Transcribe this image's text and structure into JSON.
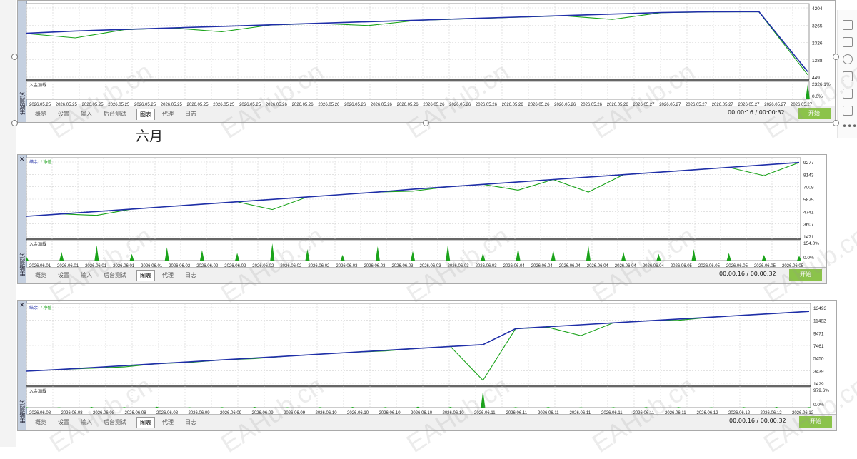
{
  "month_heading": "六月",
  "watermark": "EAHub.cn",
  "tabs": [
    "概览",
    "设置",
    "输入",
    "后台测试",
    "图表",
    "代理",
    "日志"
  ],
  "active_tab": "图表",
  "side_label": "策略测试",
  "timer": "00:00:16 / 00:00:32",
  "start_label": "开始",
  "colors": {
    "balance": "#1f2ea8",
    "equity": "#1aa31a",
    "grid": "#d0d0d0",
    "accent": "#8bc34a"
  },
  "panels": [
    {
      "legend_balance": "",
      "legend_equity": "",
      "load_label": "入金加载",
      "y_ticks": [
        "4204",
        "3265",
        "2326",
        "1388",
        "449"
      ],
      "load_ticks": [
        "2326.1%",
        "0.0%"
      ],
      "x_labels": [
        "2026.05.25",
        "2026.05.25",
        "2026.05.25",
        "2026.05.25",
        "2026.05.25",
        "2026.05.25",
        "2026.05.25",
        "2026.05.25",
        "2026.05.25",
        "2026.05.26",
        "2026.05.26",
        "2026.05.26",
        "2026.05.26",
        "2026.05.26",
        "2026.05.26",
        "2026.05.26",
        "2026.05.26",
        "2026.05.26",
        "2026.05.26",
        "2026.05.26",
        "2026.05.26",
        "2026.05.26",
        "2026.05.26",
        "2026.05.27",
        "2026.05.27",
        "2026.05.27",
        "2026.05.27",
        "2026.05.27",
        "2026.05.27",
        "2026.05.27"
      ]
    },
    {
      "legend_balance": "结余",
      "legend_equity": "净值",
      "load_label": "入金加载",
      "y_ticks": [
        "9277",
        "8143",
        "7009",
        "5875",
        "4741",
        "3607",
        "1471"
      ],
      "load_ticks": [
        "154.0%",
        "0.0%"
      ],
      "x_labels": [
        "2026.06.01",
        "2026.06.01",
        "2026.06.01",
        "2026.06.01",
        "2026.06.01",
        "2026.06.02",
        "2026.06.02",
        "2026.06.02",
        "2026.06.02",
        "2026.06.02",
        "2026.06.02",
        "2026.06.03",
        "2026.06.03",
        "2026.06.03",
        "2026.06.03",
        "2026.06.03",
        "2026.06.03",
        "2026.06.04",
        "2026.06.04",
        "2026.06.04",
        "2026.06.04",
        "2026.06.04",
        "2026.06.04",
        "2026.06.05",
        "2026.06.05",
        "2026.06.05",
        "2026.06.05",
        "2026.06.05"
      ]
    },
    {
      "legend_balance": "结余",
      "legend_equity": "净值",
      "load_label": "入金加载",
      "y_ticks": [
        "13493",
        "11482",
        "9471",
        "7461",
        "5450",
        "3439",
        "1429"
      ],
      "load_ticks": [
        "979.6%",
        "0.0%"
      ],
      "x_labels": [
        "2026.06.08",
        "2026.06.08",
        "2026.06.08",
        "2026.06.08",
        "2026.06.08",
        "2026.06.09",
        "2026.06.09",
        "2026.06.09",
        "2026.06.09",
        "2026.06.10",
        "2026.06.10",
        "2026.06.10",
        "2026.06.10",
        "2026.06.10",
        "2026.06.11",
        "2026.06.11",
        "2026.06.11",
        "2026.06.11",
        "2026.06.11",
        "2026.06.11",
        "2026.06.11",
        "2026.06.12",
        "2026.06.12",
        "2026.06.12",
        "2026.06.12"
      ]
    }
  ],
  "chart_data": [
    {
      "type": "line",
      "title": "",
      "ylim": [
        0,
        4600
      ],
      "x_range": [
        "2026.05.25",
        "2026.05.27"
      ],
      "series": [
        {
          "name": "",
          "values": [
            2900,
            3050,
            3150,
            3250,
            3350,
            3450,
            3550,
            3650,
            3750,
            3850,
            3950,
            4050,
            4150,
            4250,
            4300,
            4310,
            400
          ]
        },
        {
          "name": "",
          "values": [
            2880,
            2600,
            3130,
            3240,
            3000,
            3440,
            3540,
            3400,
            3740,
            3840,
            3940,
            4040,
            3800,
            4240,
            4290,
            4300,
            200
          ]
        }
      ],
      "load": [
        0,
        0,
        1,
        0,
        0,
        2,
        0,
        0,
        1,
        0,
        0,
        1,
        0,
        0,
        2,
        0,
        100
      ]
    },
    {
      "type": "line",
      "title": "",
      "ylim": [
        1471,
        9277
      ],
      "x_range": [
        "2026.06.01",
        "2026.06.05"
      ],
      "series": [
        {
          "name": "结余",
          "values": [
            3607,
            3850,
            4100,
            4350,
            4600,
            4850,
            5100,
            5350,
            5600,
            5850,
            6100,
            6400,
            6650,
            6900,
            7150,
            7400,
            7650,
            7900,
            8150,
            8400,
            8650,
            8900,
            9150
          ]
        },
        {
          "name": "净值",
          "values": [
            3607,
            3850,
            3700,
            4350,
            4600,
            4850,
            5100,
            4300,
            5600,
            5850,
            6100,
            6200,
            6650,
            6900,
            6300,
            7400,
            6100,
            7900,
            8150,
            8400,
            8650,
            7800,
            9150
          ]
        }
      ],
      "load": [
        20,
        45,
        80,
        35,
        70,
        55,
        40,
        90,
        60,
        30,
        75,
        50,
        85,
        40,
        65,
        55,
        80,
        45,
        35,
        60,
        40,
        30,
        25
      ]
    },
    {
      "type": "line",
      "title": "",
      "ylim": [
        1429,
        13493
      ],
      "x_range": [
        "2026.06.08",
        "2026.06.12"
      ],
      "series": [
        {
          "name": "结余",
          "values": [
            3439,
            3700,
            4000,
            4300,
            4600,
            4900,
            5200,
            5500,
            5800,
            6100,
            6400,
            6700,
            7000,
            7300,
            7600,
            10100,
            10400,
            10700,
            11000,
            11300,
            11600,
            11900,
            12200,
            12500,
            12800
          ]
        },
        {
          "name": "净值",
          "values": [
            3439,
            3700,
            3900,
            4100,
            4600,
            4800,
            5200,
            5400,
            5800,
            6100,
            6400,
            6600,
            7000,
            7300,
            2000,
            10100,
            10300,
            9000,
            11000,
            11300,
            11400,
            11900,
            12200,
            12500,
            12800
          ]
        }
      ],
      "load": [
        3,
        2,
        4,
        3,
        5,
        2,
        3,
        4,
        2,
        3,
        4,
        3,
        5,
        4,
        100,
        3,
        4,
        2,
        3,
        4,
        3,
        2,
        3,
        4,
        3
      ]
    }
  ]
}
